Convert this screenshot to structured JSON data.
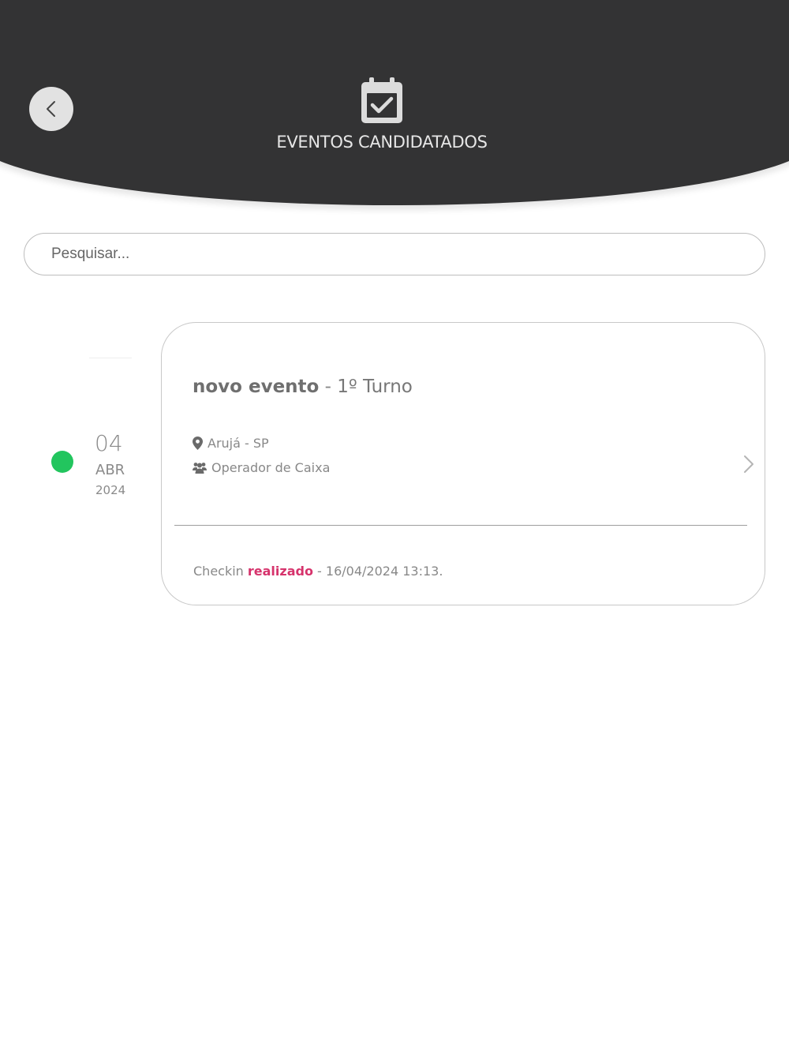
{
  "header": {
    "title": "EVENTOS CANDIDATADOS",
    "icon": "calendar-check-icon",
    "back_icon": "chevron-left-icon",
    "background_color": "#333334"
  },
  "search": {
    "placeholder": "Pesquisar...",
    "value": ""
  },
  "events": [
    {
      "status_color": "#22c55e",
      "date": {
        "day": "04",
        "month": "ABR",
        "year": "2024"
      },
      "name": "novo evento",
      "separator": " - ",
      "shift": "1º Turno",
      "location": "Arujá - SP",
      "location_icon": "map-pin-icon",
      "role": "Operador de Caixa",
      "role_icon": "users-icon",
      "checkin": {
        "prefix": "Checkin ",
        "status": "realizado",
        "suffix": " - 16/04/2024 13:13.",
        "status_color": "#d6336c"
      }
    }
  ]
}
